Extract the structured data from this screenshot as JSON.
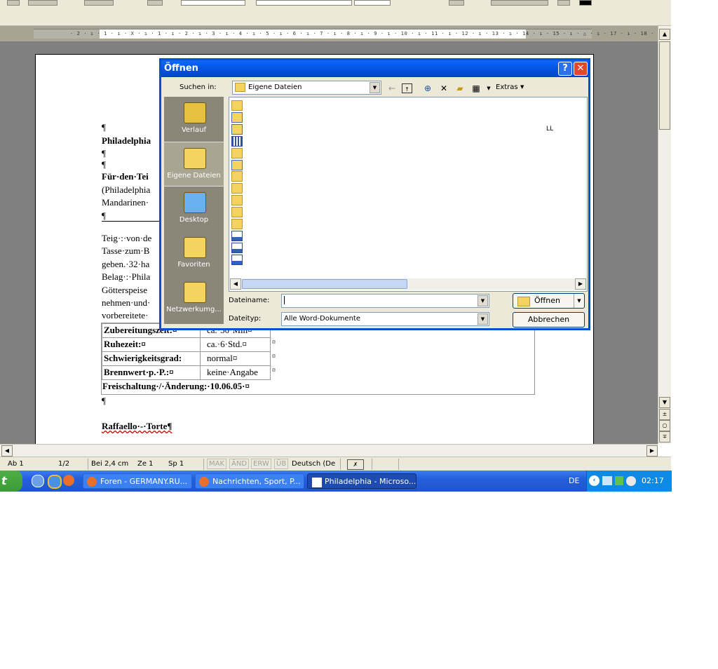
{
  "document": {
    "lines": [
      {
        "text": "¶",
        "bold": false
      },
      {
        "text": "Philadelphia",
        "bold": true
      },
      {
        "text": "¶",
        "bold": false
      },
      {
        "text": "¶",
        "bold": false
      },
      {
        "text": "Für·den·Tei",
        "bold": true
      },
      {
        "text": "(Philadelphia",
        "bold": false
      },
      {
        "text": "Mandarinen·",
        "bold": false
      },
      {
        "text": "¶",
        "bold": false
      },
      {
        "text": "Teig·:·von·de",
        "bold": false
      },
      {
        "text": "Tasse·zum·B",
        "bold": false
      },
      {
        "text": "geben.·32·ha",
        "bold": false
      },
      {
        "text": "Belag·:·Phila",
        "bold": false
      },
      {
        "text": "Götterspeise",
        "bold": false
      },
      {
        "text": "nehmen·und·",
        "bold": false
      },
      {
        "text": "vorbereitete·",
        "bold": false
      }
    ],
    "table": [
      {
        "label": "Zubereitungszeit:¤",
        "value": "ca.·30·Min¤",
        "end": "¤"
      },
      {
        "label": "Ruhezeit:¤",
        "value": "ca.·6·Std.¤",
        "end": "¤"
      },
      {
        "label": "Schwierigkeitsgrad:",
        "value": "normal¤",
        "end": "¤"
      },
      {
        "label": "Brennwert·p.·P.:¤",
        "value": "keine·Angabe",
        "end": "¤"
      }
    ],
    "footer_row": "Freischaltung·/·Änderung:·10.06.05·¤",
    "after_para": "¶",
    "next_title": "Raffaello·-·Torte¶"
  },
  "ruler": {
    "text": "· 2 · ı · 1 · ı · X · ı · 1 · ı · 2 · ı · 3 · ı · 4 · ı · 5 · ı · 6 · ı · 7 · ı · 8 · ı · 9 · ı · 10 · ı · 11 · ı · 12 · ı · 13 · ı · 14 · ı · 15 · ı · △ · ı · 17 · ı · 18 ·"
  },
  "status": {
    "page_section": "Ab 1",
    "page_count": "1/2",
    "position": "Bei 2,4 cm",
    "line": "Ze 1",
    "column": "Sp 1",
    "mak": "MAK",
    "and": "ÄND",
    "erw": "ERW",
    "ub": "ÜB",
    "language": "Deutsch (De"
  },
  "taskbar": {
    "start_label": "t",
    "tasks": [
      {
        "label": "Foren - GERMANY.RU...",
        "icon": "firefox-icon"
      },
      {
        "label": "Nachrichten, Sport, P...",
        "icon": "firefox-icon"
      },
      {
        "label": "Philadelphia - Microso...",
        "icon": "word-icon"
      }
    ],
    "lang": "DE",
    "clock": "02:17"
  },
  "dialog": {
    "title": "Öffnen",
    "help": "?",
    "close": "✕",
    "look_in_label": "Suchen in:",
    "look_in_value": "Eigene Dateien",
    "extras_label": "Extras",
    "places": [
      {
        "label": "Verlauf",
        "icon": "history-icon"
      },
      {
        "label": "Eigene Dateien",
        "icon": "my-documents-icon"
      },
      {
        "label": "Desktop",
        "icon": "desktop-icon"
      },
      {
        "label": "Favoriten",
        "icon": "favorites-icon"
      },
      {
        "label": "Netzwerkumg...",
        "icon": "network-icon"
      }
    ],
    "file_stub": "LL",
    "filename_label": "Dateiname:",
    "filename_value": "",
    "filetype_label": "Dateityp:",
    "filetype_value": "Alle Word-Dokumente",
    "open_button": "Öffnen",
    "cancel_button": "Abbrechen"
  },
  "colors": {
    "titlebar": "#0454e0",
    "taskbar": "#245edc",
    "start": "#3c9a35"
  }
}
